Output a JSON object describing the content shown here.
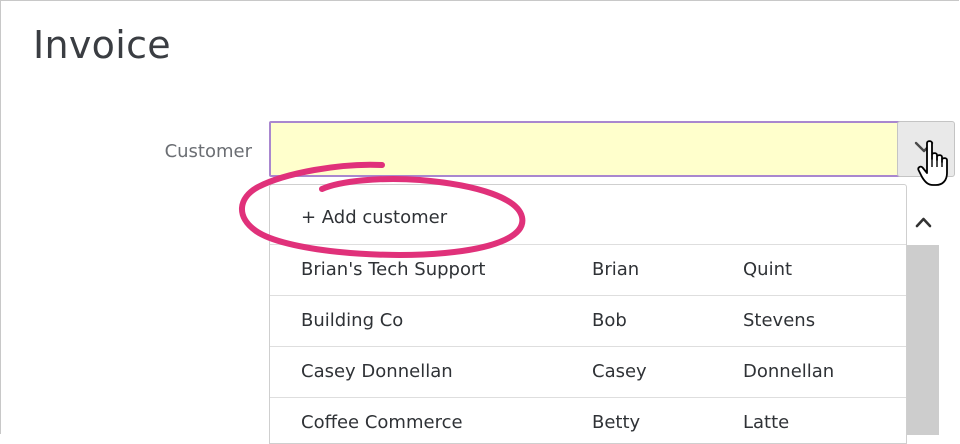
{
  "page": {
    "title": "Invoice"
  },
  "customer_field": {
    "label": "Customer",
    "value": "",
    "placeholder": ""
  },
  "dropdown": {
    "toggle_icon": "chevron-down-icon",
    "add_label": "+ Add customer",
    "customers": [
      {
        "company": "Brian's Tech Support",
        "first": "Brian",
        "last": "Quint"
      },
      {
        "company": "Building Co",
        "first": "Bob",
        "last": "Stevens"
      },
      {
        "company": "Casey Donnellan",
        "first": "Casey",
        "last": "Donnellan"
      },
      {
        "company": "Coffee Commerce",
        "first": "Betty",
        "last": "Latte"
      }
    ],
    "scroll_up_icon": "chevron-up-icon"
  },
  "colors": {
    "input_background": "#ffffcc",
    "input_focus_border": "#a987cf",
    "annotation": "#e0317a",
    "scrollbar_thumb": "#cdcdcd"
  },
  "overlays": {
    "annotation": "highlight-circle",
    "cursor_icon": "hand-pointer-icon"
  }
}
